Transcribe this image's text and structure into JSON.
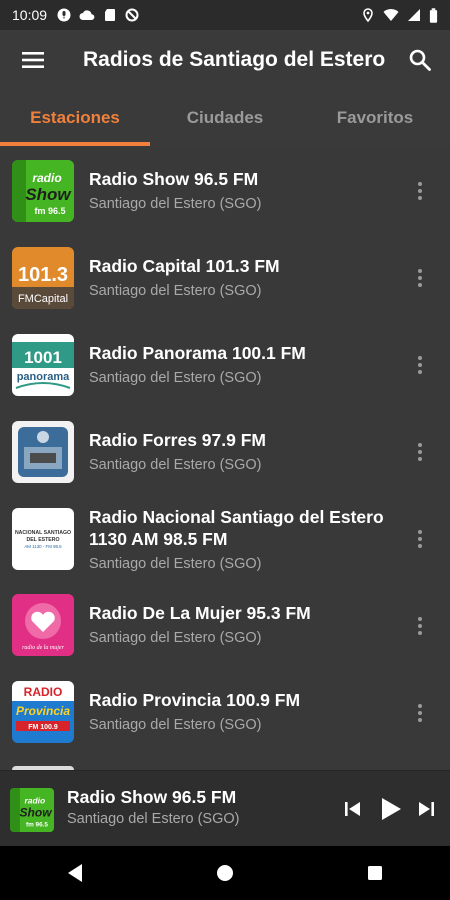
{
  "status_bar": {
    "time": "10:09",
    "left_icons": [
      "mic-icon",
      "cloud-icon",
      "sd-card-icon",
      "no-sim-icon"
    ],
    "right_icons": [
      "location-icon",
      "wifi-icon",
      "signal-icon",
      "battery-icon"
    ]
  },
  "app_bar": {
    "title": "Radios de Santiago del Estero",
    "menu_icon": "hamburger-menu-icon",
    "search_icon": "search-icon"
  },
  "tabs": [
    {
      "label": "Estaciones",
      "active": true
    },
    {
      "label": "Ciudades",
      "active": false
    },
    {
      "label": "Favoritos",
      "active": false
    }
  ],
  "stations": [
    {
      "name": "Radio Show 96.5 FM",
      "location": "Santiago del Estero (SGO)"
    },
    {
      "name": "Radio Capital 101.3 FM",
      "location": "Santiago del Estero (SGO)"
    },
    {
      "name": "Radio Panorama 100.1 FM",
      "location": "Santiago del Estero (SGO)"
    },
    {
      "name": "Radio Forres 97.9 FM",
      "location": "Santiago del Estero (SGO)"
    },
    {
      "name": "Radio Nacional Santiago del Estero 1130 AM 98.5 FM",
      "location": "Santiago del Estero (SGO)"
    },
    {
      "name": "Radio De La Mujer 95.3 FM",
      "location": "Santiago del Estero (SGO)"
    },
    {
      "name": "Radio Provincia 100.9 FM",
      "location": "Santiago del Estero (SGO)"
    }
  ],
  "logos": {
    "show": {
      "line1": "radio",
      "line2": "Show",
      "line3": "fm 96.5"
    },
    "capital": {
      "line1": "101.3",
      "line2": "FMCapital"
    },
    "panorama": {
      "line1": "1001",
      "line2": "panorama"
    },
    "nacional": {
      "line1": "NACIONAL SANTIAGO",
      "line2": "DEL ESTERO",
      "line3": "AM 1130 - FM 98.5"
    },
    "mujer": {
      "line1": "radio de la mujer"
    },
    "provincia": {
      "line1": "RADIO",
      "line2": "Provincia",
      "line3": "FM 100.9"
    }
  },
  "player": {
    "name": "Radio Show 96.5 FM",
    "location": "Santiago del Estero (SGO)",
    "controls": [
      "skip-previous-icon",
      "play-icon",
      "skip-next-icon"
    ]
  },
  "colors": {
    "accent": "#f0803c",
    "background": "#3a3a3a",
    "player_background": "#2e2e2e"
  }
}
